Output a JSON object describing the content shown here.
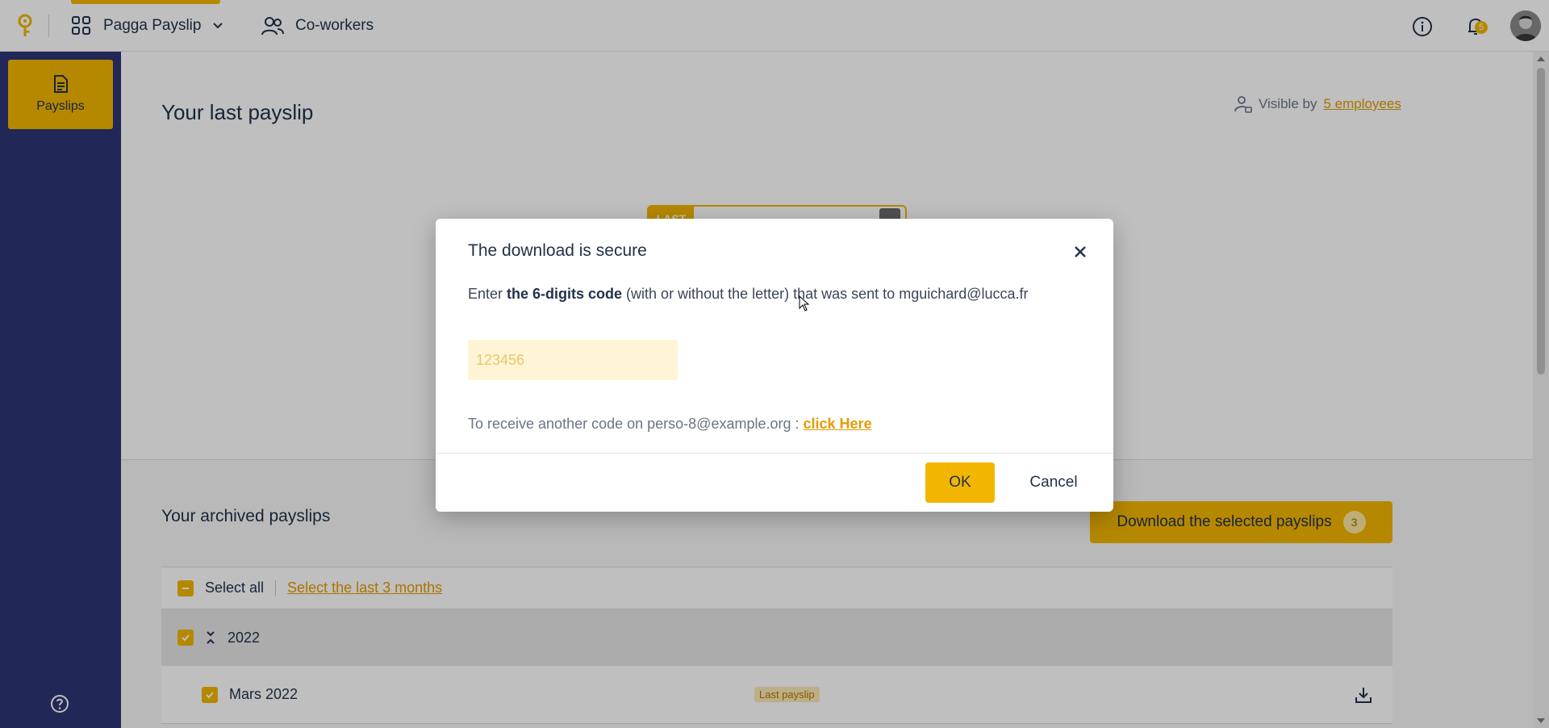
{
  "topbar": {
    "app_name": "Pagga Payslip",
    "coworkers_label": "Co-workers",
    "notifications_count": "5"
  },
  "sidebar": {
    "items": [
      {
        "label": "Payslips",
        "icon": "document-icon"
      }
    ]
  },
  "main": {
    "page_title": "Your last payslip",
    "visible_by_prefix": "Visible by",
    "visible_by_link": "5 employees",
    "last_tag": "LAST",
    "archived_title": "Your archived payslips",
    "download_button": "Download the selected payslips",
    "download_count": "3",
    "select_all": "Select all",
    "select_last_months": "Select the last 3 months",
    "year": "2022",
    "rows": [
      {
        "month": "Mars 2022",
        "badge": "Last payslip"
      }
    ]
  },
  "modal": {
    "title": "The download is secure",
    "desc_prefix": "Enter ",
    "desc_bold": "the 6-digits code",
    "desc_suffix": " (with or without the letter) that was sent to mguichard@lucca.fr",
    "code_placeholder": "123456",
    "resend_prefix": "To receive another code on perso-8@example.org : ",
    "resend_link": "click Here",
    "ok_label": "OK",
    "cancel_label": "Cancel"
  },
  "colors": {
    "accent": "#f2b600",
    "sidebar": "#2c3473",
    "text": "#22324a",
    "link": "#e39b00"
  }
}
